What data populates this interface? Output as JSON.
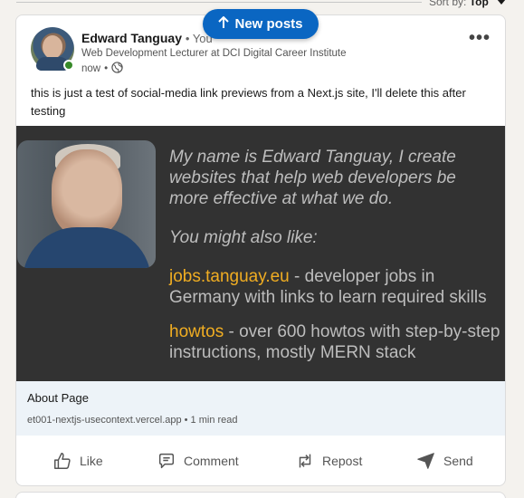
{
  "feed": {
    "sort_label": "Sort by:",
    "sort_value": "Top",
    "new_posts_label": "New posts"
  },
  "post": {
    "author_name": "Edward Tanguay",
    "author_relation": "You",
    "author_headline": "Web Development Lecturer at DCI Digital Career Institute",
    "time": "now",
    "visibility_icon": "globe-icon",
    "text": "this is just a test of social-media link previews from a Next.js site, I'll delete this after testing",
    "preview": {
      "intro": "My name is Edward Tanguay, I create websites that help web developers be more effective at what we do.",
      "also_like": "You might also like:",
      "item1_link": "jobs.tanguay.eu",
      "item1_text": " - developer jobs in Germany with links to learn required skills",
      "item2_link": "howtos",
      "item2_text": " - over 600 howtos with step-by-step instructions, mostly MERN stack"
    },
    "link": {
      "title": "About Page",
      "meta": "et001-nextjs-usecontext.vercel.app • 1 min read"
    },
    "actions": {
      "like": "Like",
      "comment": "Comment",
      "repost": "Repost",
      "send": "Send"
    }
  },
  "colors": {
    "brand_blue": "#0a66c2",
    "online_green": "#378a29",
    "preview_bg": "#323232",
    "preview_link": "#f0ad22"
  }
}
